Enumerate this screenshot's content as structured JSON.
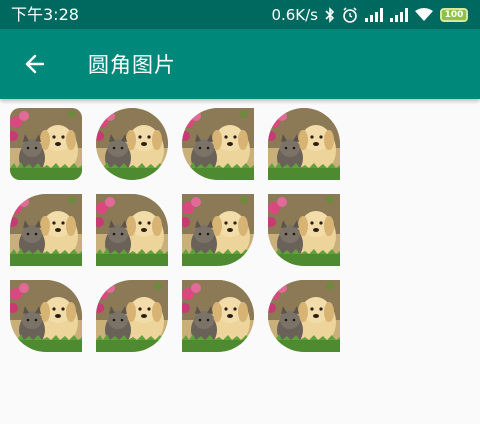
{
  "status_bar": {
    "time": "下午3:28",
    "net_speed": "0.6K/s",
    "battery": "100",
    "icons": [
      "bluetooth-icon",
      "alarm-icon",
      "signal-icon",
      "signal-icon",
      "wifi-icon",
      "battery-icon"
    ]
  },
  "app_bar": {
    "title": "圆角图片",
    "back_icon": "arrow-left-icon",
    "color": "#00897b"
  },
  "grid": {
    "image": "puppy-and-kitten-photo",
    "items": [
      {
        "corners": "10 10 10 10"
      },
      {
        "corners": "36 36 36 36"
      },
      {
        "corners": "36 0 0 36"
      },
      {
        "corners": "36 36 0 0"
      },
      {
        "corners": "36 0 0 0"
      },
      {
        "corners": "0 36 0 0"
      },
      {
        "corners": "0 0 36 0"
      },
      {
        "corners": "0 0 0 36"
      },
      {
        "corners": "0 36 0 36"
      },
      {
        "corners": "36 0 36 0"
      },
      {
        "corners": "0 36 36 0"
      },
      {
        "corners": "36 0 0 36"
      }
    ]
  }
}
